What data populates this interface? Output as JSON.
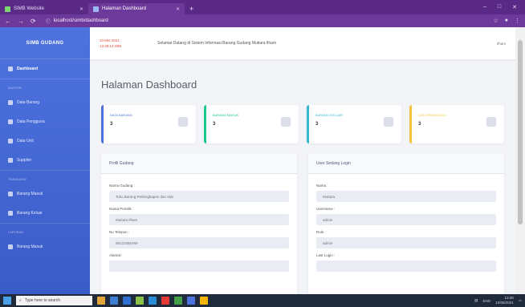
{
  "browser": {
    "tabs": [
      {
        "label": "SIMB Website"
      },
      {
        "label": "Halaman Dashboard"
      }
    ],
    "new_tab": "+",
    "window_controls": {
      "minimize": "–",
      "maximize": "□",
      "close": "✕"
    },
    "url": "localhost/simb/dashboard"
  },
  "sidebar": {
    "brand": "SIMB GUDANG",
    "items": [
      {
        "label": "Dashboard",
        "active": true
      },
      {
        "section": "Master"
      },
      {
        "label": "Data Barang"
      },
      {
        "label": "Data Pengguna"
      },
      {
        "label": "Data Unit"
      },
      {
        "label": "Supplier"
      },
      {
        "section": "Transaksi"
      },
      {
        "label": "Barang Masuk"
      },
      {
        "label": "Barang Keluar"
      },
      {
        "section": "Laporan"
      },
      {
        "label": "Barang Masuk"
      }
    ]
  },
  "topbar": {
    "date": "10 Mei 2021",
    "time": "13:28:14 WIB",
    "welcome": "Selamat Datang di Sistem Informasi Barang Gudang Mutiara Ilham",
    "user": "Ilham"
  },
  "page_title": "Halaman Dashboard",
  "stats": [
    {
      "label": "DATA BARANG",
      "value": "3",
      "color": "#4e73df"
    },
    {
      "label": "BARANG MASUK",
      "value": "3",
      "color": "#1cc88a"
    },
    {
      "label": "BARANG KELUAR",
      "value": "3",
      "color": "#36b9cc"
    },
    {
      "label": "DATA PENGGUNA",
      "value": "3",
      "color": "#f6c23e"
    }
  ],
  "profile_panel": {
    "title": "Profil Gudang",
    "fields": [
      {
        "label": "Nama Gudang :",
        "value": "Toko Barang Perlengkapan dan Alat"
      },
      {
        "label": "Nama Pemilik :",
        "value": "Mutiara Ilham"
      },
      {
        "label": "No Telepon :",
        "value": "08123456789"
      },
      {
        "label": "Alamat :",
        "value": ""
      }
    ]
  },
  "user_panel": {
    "title": "User Sedang Login",
    "fields": [
      {
        "label": "Nama :",
        "value": "Mutiara"
      },
      {
        "label": "Username :",
        "value": "admin"
      },
      {
        "label": "Role :",
        "value": "admin"
      },
      {
        "label": "Last Login :",
        "value": ""
      }
    ]
  },
  "taskbar": {
    "search_placeholder": "Type here to search",
    "lang": "ENG",
    "time": "13:28",
    "date": "10/05/2021"
  }
}
